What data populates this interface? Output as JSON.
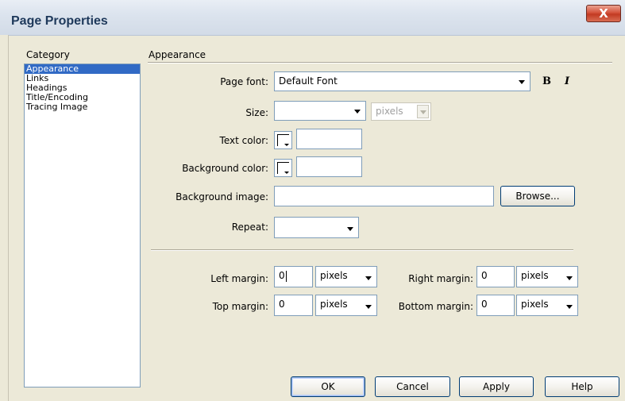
{
  "window": {
    "title": "Page Properties",
    "close_glyph": "X"
  },
  "category": {
    "label": "Category",
    "items": [
      "Appearance",
      "Links",
      "Headings",
      "Title/Encoding",
      "Tracing Image"
    ],
    "selected": "Appearance"
  },
  "panel": {
    "heading": "Appearance",
    "page_font": {
      "label": "Page font:",
      "value": "Default Font"
    },
    "size": {
      "label": "Size:",
      "value": "",
      "unit": "pixels"
    },
    "text_color": {
      "label": "Text color:",
      "value": ""
    },
    "background_color": {
      "label": "Background color:",
      "value": ""
    },
    "background_image": {
      "label": "Background image:",
      "value": "",
      "browse": "Browse..."
    },
    "repeat": {
      "label": "Repeat:",
      "value": ""
    },
    "left_margin": {
      "label": "Left margin:",
      "value": "0",
      "unit": "pixels"
    },
    "right_margin": {
      "label": "Right margin:",
      "value": "0",
      "unit": "pixels"
    },
    "top_margin": {
      "label": "Top margin:",
      "value": "0",
      "unit": "pixels"
    },
    "bottom_margin": {
      "label": "Bottom margin:",
      "value": "0",
      "unit": "pixels"
    }
  },
  "buttons": {
    "ok": "OK",
    "cancel": "Cancel",
    "apply": "Apply",
    "help": "Help"
  },
  "style_icons": {
    "bold": "B",
    "italic": "I"
  },
  "colors": {
    "selection": "#316ac5",
    "dialog_bg": "#ece9d8",
    "title_text": "#1e395b",
    "close_red": "#c23a22"
  }
}
